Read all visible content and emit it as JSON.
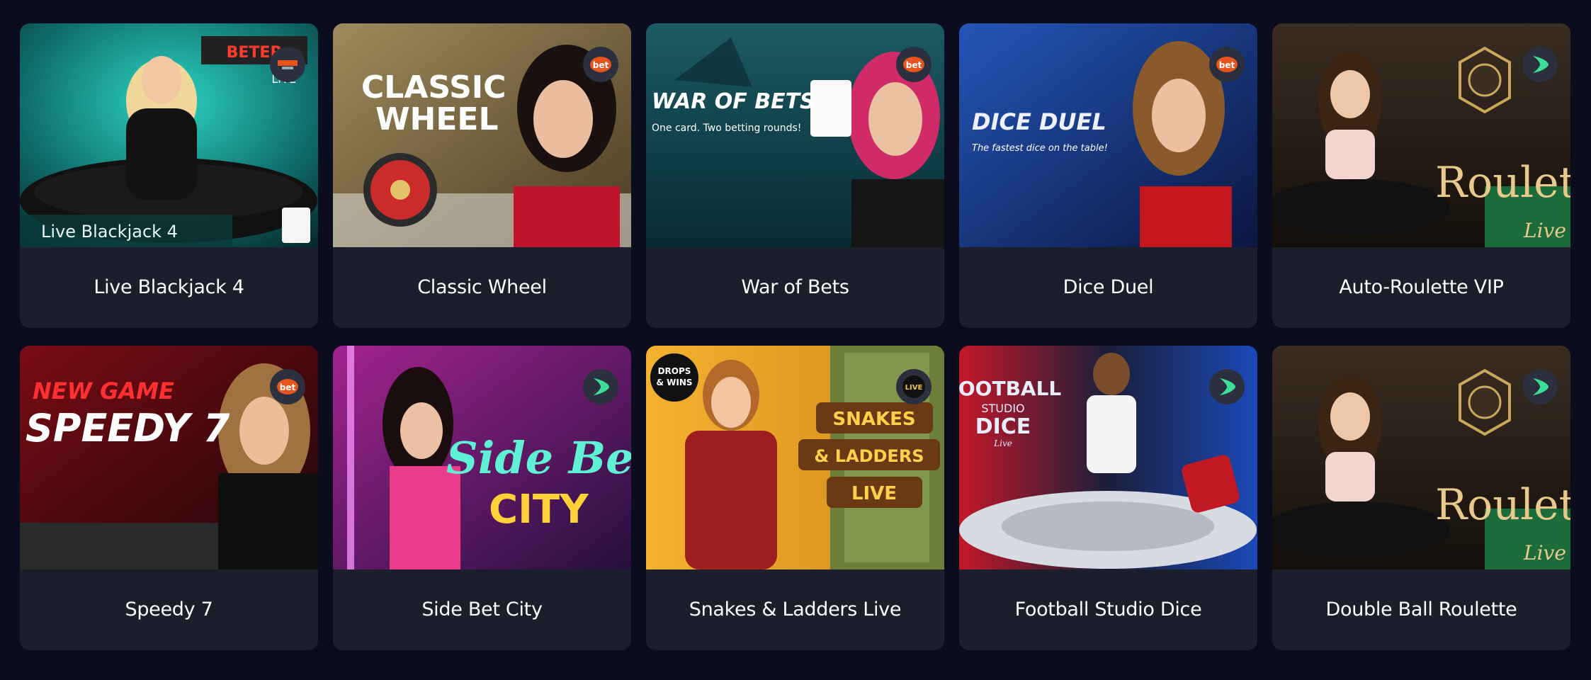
{
  "games": [
    {
      "title": "Live Blackjack 4",
      "provider": "BETER LIVE",
      "art_text": [
        "BETER",
        "LIVE",
        "Live Blackjack 4"
      ]
    },
    {
      "title": "Classic Wheel",
      "provider": "bet",
      "art_text": [
        "CLASSIC",
        "WHEEL"
      ]
    },
    {
      "title": "War of Bets",
      "provider": "bet",
      "art_text": [
        "WAR OF BETS",
        "One card. Two betting rounds!"
      ]
    },
    {
      "title": "Dice Duel",
      "provider": "bet",
      "art_text": [
        "DICE DUEL",
        "The fastest dice on the table!"
      ]
    },
    {
      "title": "Auto-Roulette VIP",
      "provider": "evolution",
      "art_text": [
        "Roulette",
        "Live"
      ]
    },
    {
      "title": "Speedy 7",
      "provider": "bet",
      "art_text": [
        "NEW GAME",
        "SPEEDY 7"
      ]
    },
    {
      "title": "Side Bet City",
      "provider": "evolution",
      "art_text": [
        "Side Bet",
        "CITY"
      ]
    },
    {
      "title": "Snakes & Ladders Live",
      "provider": "LIVE",
      "art_text": [
        "DROPS",
        "& WINS",
        "SNAKES",
        "& LADDERS",
        "LIVE"
      ]
    },
    {
      "title": "Football Studio Dice",
      "provider": "evolution",
      "art_text": [
        "FOOTBALL",
        "STUDIO",
        "DICE",
        "Live"
      ]
    },
    {
      "title": "Double Ball Roulette",
      "provider": "evolution",
      "art_text": [
        "Roulette",
        "Live"
      ]
    }
  ],
  "colors": {
    "page_bg": "#0b0c1e",
    "card_bg": "#1b1e2b",
    "badge_bg": "#2c2f3d",
    "bet_orange": "#e8541e",
    "evolution_green": "#3ddc97"
  }
}
